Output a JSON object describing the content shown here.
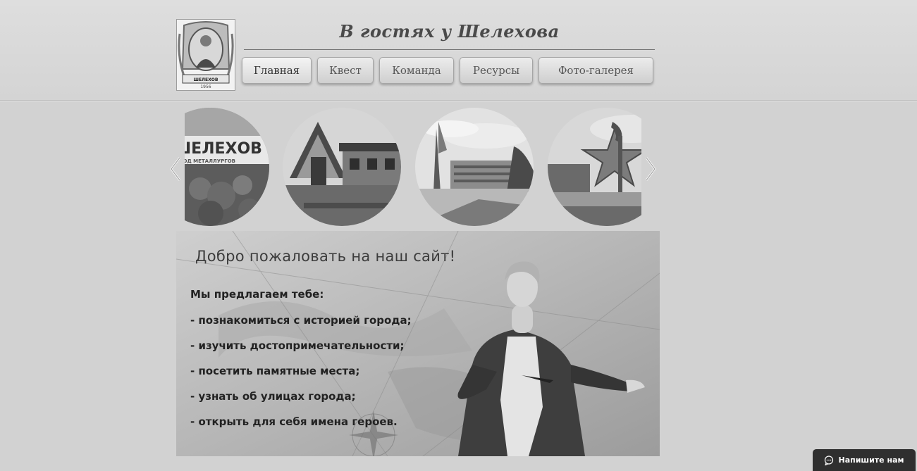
{
  "header": {
    "site_title": "В гостях у Шелехова",
    "logo_caption": "ШЕЛЕХОВ",
    "logo_year": "1956",
    "nav": [
      {
        "label": "Главная",
        "active": true
      },
      {
        "label": "Квест",
        "active": false
      },
      {
        "label": "Команда",
        "active": false
      },
      {
        "label": "Ресурсы",
        "active": false
      },
      {
        "label": "Фото-галерея",
        "active": false
      }
    ]
  },
  "carousel": {
    "prev_icon": "chevron-left-icon",
    "next_icon": "chevron-right-icon",
    "slides": [
      {
        "subject": "city-sign",
        "sign_text": "ШЕЛЕХОВ",
        "sign_sub": "ГОРОД МЕТАЛЛУРГОВ"
      },
      {
        "subject": "wooden-house"
      },
      {
        "subject": "monument-sail"
      },
      {
        "subject": "star-monument"
      }
    ]
  },
  "banner": {
    "title": "Добро пожаловать на наш сайт!",
    "intro": "Мы предлагаем тебе:",
    "items": [
      "- познакомиться с историей города;",
      "- изучить достопримечательности;",
      "- посетить памятные места;",
      "- узнать об улицах города;",
      "- открыть для себя имена героев."
    ]
  },
  "chat": {
    "label": "Напишите нам",
    "icon": "chat-bubble-icon"
  },
  "colors": {
    "page_bg": "#d2d2d2",
    "chat_bg": "#2f2f2f"
  }
}
